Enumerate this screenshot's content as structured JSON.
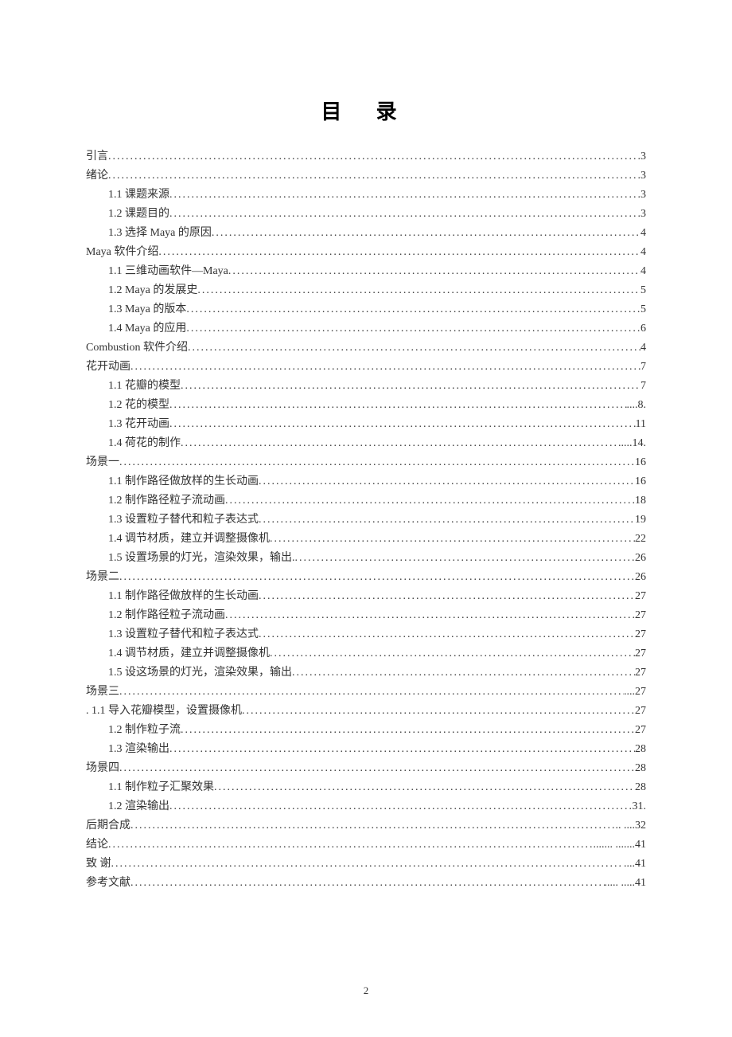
{
  "title": "目 录",
  "page_number": "2",
  "toc": [
    {
      "label": "引言",
      "page": "3",
      "indent": false
    },
    {
      "label": "绪论",
      "page": "3",
      "indent": false
    },
    {
      "label": "1.1 课题来源",
      "page": "3",
      "indent": true
    },
    {
      "label": "1.2 课题目的",
      "page": "3",
      "indent": true
    },
    {
      "label": "1.3 选择 Maya 的原因",
      "page": " 4",
      "indent": true
    },
    {
      "label": "Maya 软件介绍",
      "page": "4",
      "indent": false
    },
    {
      "label": "1.1 三维动画软件—Maya",
      "page": "4",
      "indent": true
    },
    {
      "label": "1.2 Maya 的发展史",
      "page": "5",
      "indent": true
    },
    {
      "label": "1.3 Maya 的版本",
      "page": "5",
      "indent": true
    },
    {
      "label": "1.4 Maya 的应用",
      "page": "6",
      "indent": true
    },
    {
      "label": "Combustion 软件介绍",
      "page": "4",
      "indent": false
    },
    {
      "label": "花开动画",
      "page": "7",
      "indent": false
    },
    {
      "label": "1.1 花瓣的模型 ",
      "page": "7",
      "indent": true
    },
    {
      "label": "1.2 花的模型",
      "page": " ....8.",
      "indent": true
    },
    {
      "label": "1.3 花开动画",
      "page": "11",
      "indent": true
    },
    {
      "label": "1.4 荷花的制作",
      "page": " ....14.",
      "indent": true
    },
    {
      "label": "场景一",
      "page": "16",
      "indent": false
    },
    {
      "label": "1.1 制作路径做放样的生长动画",
      "page": "16",
      "indent": true
    },
    {
      "label": "1.2 制作路径粒子流动画",
      "page": "18",
      "indent": true
    },
    {
      "label": "1.3 设置粒子替代和粒子表达式",
      "page": "19",
      "indent": true
    },
    {
      "label": "1.4 调节材质，建立并调整摄像机",
      "page": "22",
      "indent": true
    },
    {
      "label": "1.5 设置场景的灯光，渲染效果，输出. ",
      "page": "26",
      "indent": true
    },
    {
      "label": "场景二",
      "page": "26",
      "indent": false
    },
    {
      "label": "1.1 制作路径做放样的生长动画",
      "page": "27",
      "indent": true
    },
    {
      "label": "1.2 制作路径粒子流动画",
      "page": "27",
      "indent": true
    },
    {
      "label": "1.3 设置粒子替代和粒子表达式",
      "page": "27",
      "indent": true
    },
    {
      "label": "1.4 调节材质，建立并调整摄像机",
      "page": "27",
      "indent": true
    },
    {
      "label": "1.5 设这场景的灯光，渲染效果，输出",
      "page": "27",
      "indent": true
    },
    {
      "label": "场景三",
      "page": " ....27",
      "indent": false
    },
    {
      "label": ". 1.1 导入花瓣模型，设置摄像机",
      "page": "27",
      "indent": false
    },
    {
      "label": "1.2 制作粒子流",
      "page": "27",
      "indent": true
    },
    {
      "label": "1.3 渲染输出",
      "page": "28",
      "indent": true
    },
    {
      "label": "场景四",
      "page": "28",
      "indent": false
    },
    {
      "label": "1.1 制作粒子汇聚效果",
      "page": "28",
      "indent": true
    },
    {
      "label": "1.2 渲染输出",
      "page": "31.",
      "indent": true
    },
    {
      "label": "后期合成",
      "page": ".. ....32",
      "indent": false
    },
    {
      "label": "结论",
      "page": " ....... .......41",
      "indent": false
    },
    {
      "label": "致    谢",
      "page": " ....41",
      "indent": false
    },
    {
      "label": "参考文献",
      "page": " ..... .....41",
      "indent": false
    }
  ]
}
